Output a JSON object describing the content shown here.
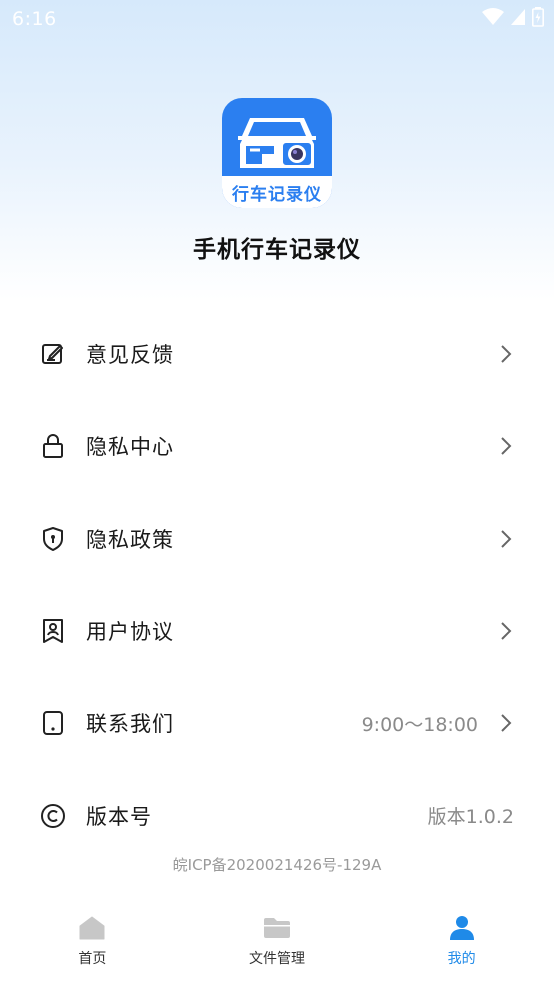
{
  "status_bar": {
    "time": "6:16"
  },
  "app": {
    "logo_text": "行车记录仪",
    "name": "手机行车记录仪",
    "brand_color": "#2b7ff0"
  },
  "menu": {
    "items": [
      {
        "label": "意见反馈",
        "icon": "feedback-edit-icon",
        "value": ""
      },
      {
        "label": "隐私中心",
        "icon": "lock-icon",
        "value": ""
      },
      {
        "label": "隐私政策",
        "icon": "shield-icon",
        "value": ""
      },
      {
        "label": "用户协议",
        "icon": "user-agreement-icon",
        "value": ""
      },
      {
        "label": "联系我们",
        "icon": "phone-icon",
        "value": "9:00～18:00"
      },
      {
        "label": "版本号",
        "icon": "copyright-icon",
        "value": "版本1.0.2"
      }
    ]
  },
  "footer": {
    "icp": "皖ICP备2020021426号-129A"
  },
  "tab_bar": {
    "tabs": [
      {
        "label": "首页",
        "icon": "home-icon",
        "active": false
      },
      {
        "label": "文件管理",
        "icon": "folder-icon",
        "active": false
      },
      {
        "label": "我的",
        "icon": "person-icon",
        "active": true
      }
    ],
    "active_color": "#1f8ae8",
    "inactive_icon_color": "#c7c7c7"
  }
}
